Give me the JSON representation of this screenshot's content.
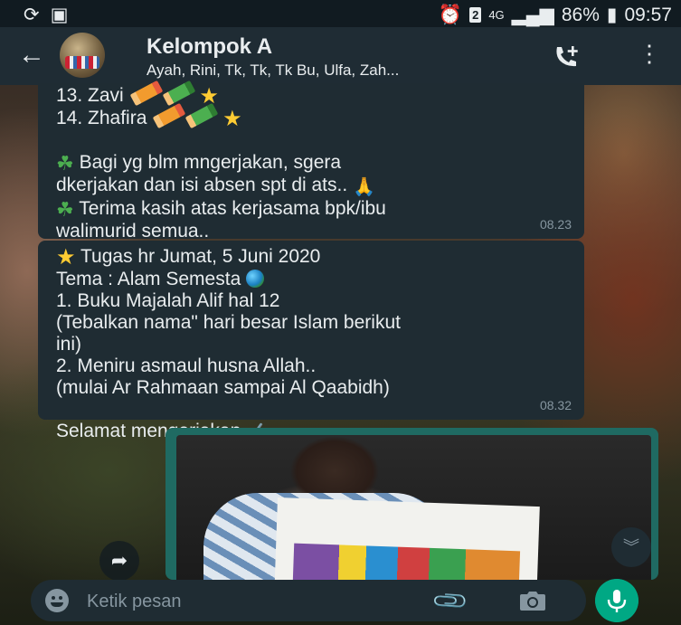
{
  "status_bar": {
    "battery": "86%",
    "time": "09:57",
    "network": "4G",
    "sim_badge": "2"
  },
  "header": {
    "group_name": "Kelompok A",
    "participants": "Ayah, Rini, Tk, Tk, Tk Bu, Ulfa, Zah..."
  },
  "messages": [
    {
      "lines": [
        "13. Zavi",
        "14. Zhafira",
        "",
        "Bagi yg blm mngerjakan, sgera",
        "dkerjakan dan isi absen spt di ats..",
        "Terima kasih atas kerjasama bpk/ibu",
        "walimurid semua.."
      ],
      "time": "08.23"
    },
    {
      "lines": [
        "Tugas hr Jumat, 5 Juni 2020",
        "Tema : Alam Semesta",
        "1. Buku Majalah Alif hal 12",
        "(Tebalkan nama\" hari besar Islam berikut",
        "ini)",
        "2. Meniru asmaul husna Allah..",
        "(mulai Ar Rahmaan sampai Al Qaabidh)",
        "",
        "Selamat mengerjakan"
      ],
      "time": "08.32"
    }
  ],
  "input": {
    "placeholder": "Ketik pesan"
  },
  "icons": {
    "back": "arrow-left-icon",
    "call": "add-call-icon",
    "menu": "more-vertical-icon",
    "share": "share-arrow-icon",
    "scroll": "double-chevron-down-icon",
    "emoji": "smiley-icon",
    "attach": "paperclip-icon",
    "camera": "camera-icon",
    "mic": "microphone-icon"
  },
  "colors": {
    "accent": "#00a884",
    "bubble": "#1f2c33",
    "header": "#1f2c34"
  }
}
